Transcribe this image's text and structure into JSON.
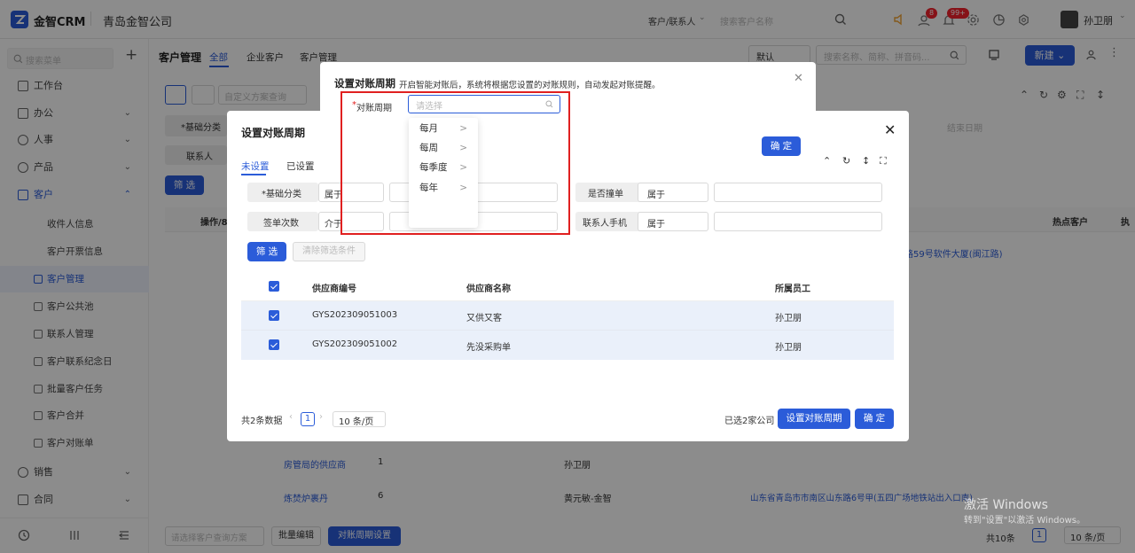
{
  "app": {
    "name": "金智CRM",
    "company": "青岛金智公司"
  },
  "topbar": {
    "search_scope": "客户/联系人",
    "search_placeholder": "搜索客户名称",
    "badge_msg": "8",
    "badge_notice": "99+",
    "user_name": "孙卫朋"
  },
  "sidebar": {
    "search_placeholder": "搜索菜单",
    "items": {
      "workbench": "工作台",
      "office": "办公",
      "hr": "人事",
      "product": "产品",
      "customer": "客户",
      "receiver": "收件人信息",
      "invoice": "客户开票信息",
      "customer_mgmt": "客户管理",
      "public_pool": "客户公共池",
      "contacts": "联系人管理",
      "anniversary": "客户联系纪念日",
      "batch_task": "批量客户任务",
      "merge": "客户合并",
      "statement": "客户对账单",
      "sales": "销售",
      "contract": "合同"
    }
  },
  "page": {
    "title": "客户管理",
    "tabs": [
      "全部",
      "企业客户",
      "客户管理"
    ],
    "view_default": "默认",
    "search_placeholder": "搜索名称、简称、拼音码...",
    "new_btn": "新建",
    "scheme_placeholder": "自定义方案查询",
    "filter_chip1": "*基础分类",
    "filter_chip2": "联系人",
    "filter_btn": "筛 选",
    "end_date_placeholder": "结束日期",
    "col_ops": "操作/8",
    "col_hot": "热点客户",
    "col_more": "执",
    "addr1": "路59号软件大厦(闽江路)",
    "row_name1": "房管局的供应商",
    "row_num1": "1",
    "row_owner1": "孙卫朋",
    "row_name2": "炼焚炉裹丹",
    "row_num2": "6",
    "row_owner2": "黄元敏-金智",
    "addr2": "山东省青岛市市南区山东路6号甲(五四广场地铁站出入口南)",
    "bottom_scheme_placeholder": "请选择客户查询方案",
    "batch_edit": "批量编辑",
    "cycle_setting": "对账周期设置",
    "total": "共10条",
    "page_num": "1",
    "page_size": "10 条/页",
    "watermark_title": "激活 Windows",
    "watermark_sub": "转到\"设置\"以激活 Windows。"
  },
  "modal": {
    "title": "设置对账周期",
    "tabs": [
      "未设置",
      "已设置"
    ],
    "f_basic": "*基础分类",
    "f_belong": "属于",
    "f_signed": "是否撞单",
    "f_belong2": "属于",
    "f_orders": "签单次数",
    "f_between": "介于",
    "f_phone": "联系人手机",
    "f_belong3": "属于",
    "filter_btn": "筛 选",
    "clear_btn": "清除筛选条件",
    "headers": [
      "供应商编号",
      "供应商名称",
      "所属员工"
    ],
    "rows": [
      {
        "code": "GYS202309051003",
        "name": "又供又客",
        "owner": "孙卫朋"
      },
      {
        "code": "GYS202309051002",
        "name": "先没采购单",
        "owner": "孙卫朋"
      }
    ],
    "total": "共2条数据",
    "page_num": "1",
    "page_size": "10 条/页",
    "selected": "已选2家公司",
    "set_cycle_btn": "设置对账周期",
    "confirm_btn": "确 定"
  },
  "dialog": {
    "title": "设置对账周期",
    "desc": "开启智能对账后，系统将根据您设置的对账规则，自动发起对账提醒。",
    "field_label": "对账周期",
    "required_mark": "*",
    "placeholder": "请选择",
    "confirm_btn": "确 定",
    "options": [
      "每月",
      "每周",
      "每季度",
      "每年"
    ]
  },
  "colors": {
    "primary": "#2b5cd9",
    "highlight_border": "#e02020"
  }
}
